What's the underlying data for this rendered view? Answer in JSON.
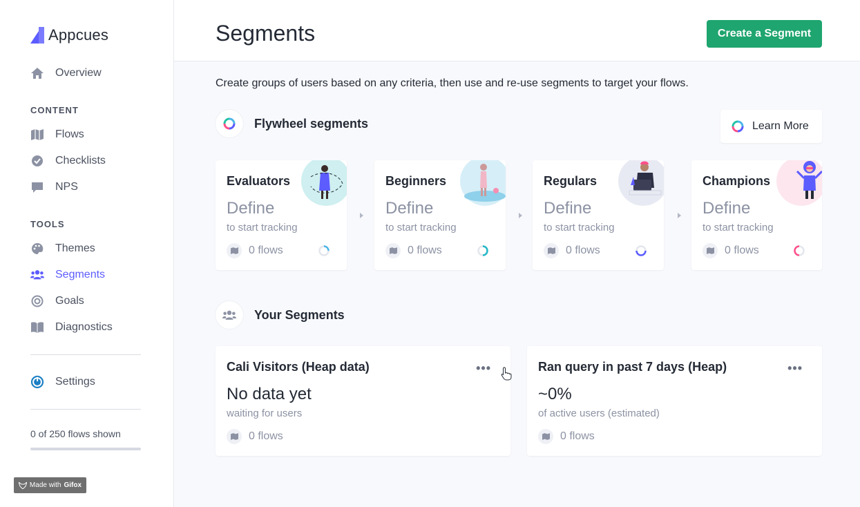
{
  "brand": {
    "name": "Appcues"
  },
  "sidebar": {
    "overview": "Overview",
    "content_heading": "CONTENT",
    "content_items": [
      "Flows",
      "Checklists",
      "NPS"
    ],
    "tools_heading": "TOOLS",
    "tools_items": [
      "Themes",
      "Segments",
      "Goals",
      "Diagnostics"
    ],
    "settings": "Settings",
    "flows_shown": "0 of 250 flows shown",
    "active_item": "Segments"
  },
  "header": {
    "title": "Segments",
    "create_button": "Create a Segment"
  },
  "intro": "Create groups of users based on any criteria, then use and re-use segments to target your flows.",
  "flywheel": {
    "title": "Flywheel segments",
    "learn_more": "Learn More",
    "cards": [
      {
        "name": "Evaluators",
        "action": "Define",
        "sub": "to start tracking",
        "flows": "0 flows"
      },
      {
        "name": "Beginners",
        "action": "Define",
        "sub": "to start tracking",
        "flows": "0 flows"
      },
      {
        "name": "Regulars",
        "action": "Define",
        "sub": "to start tracking",
        "flows": "0 flows"
      },
      {
        "name": "Champions",
        "action": "Define",
        "sub": "to start tracking",
        "flows": "0 flows"
      }
    ]
  },
  "your_segments": {
    "title": "Your Segments",
    "cards": [
      {
        "name": "Cali Visitors (Heap data)",
        "value": "No data yet",
        "sub": "waiting for users",
        "flows": "0 flows"
      },
      {
        "name": "Ran query in past 7 days (Heap)",
        "value": "~0%",
        "sub": "of active users (estimated)",
        "flows": "0 flows"
      }
    ]
  },
  "watermark": {
    "prefix": "Made with",
    "brand": "Gifox"
  },
  "colors": {
    "accent": "#5c5cff",
    "primary_button": "#1fa56f",
    "muted_text": "#8c92a3"
  }
}
